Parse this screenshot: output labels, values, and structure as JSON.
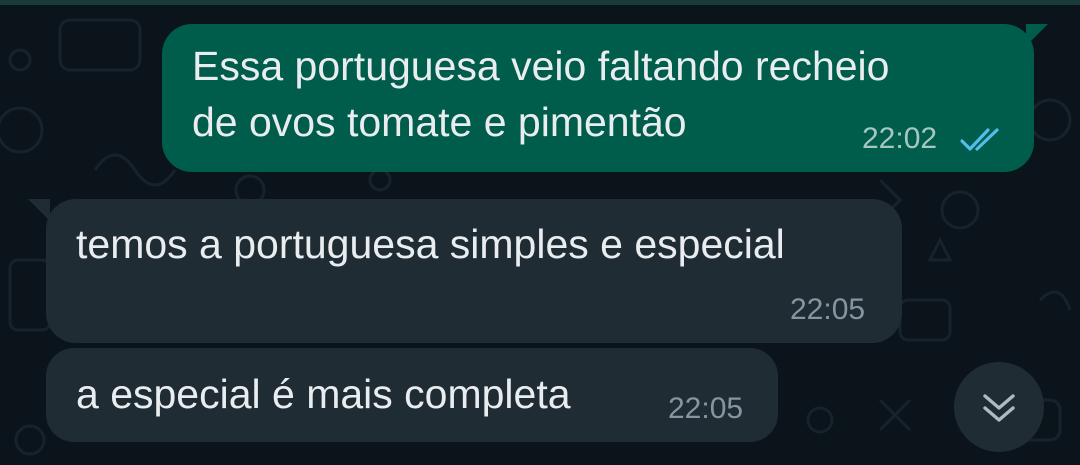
{
  "messages": [
    {
      "direction": "outgoing",
      "lines": [
        "Essa portuguesa veio faltando recheio",
        "de ovos tomate e pimentão"
      ],
      "time": "22:02",
      "status": "read",
      "status_icon": "double-check-icon",
      "status_color": "#53bdeb"
    },
    {
      "direction": "incoming",
      "lines": [
        "temos a portuguesa simples e especial"
      ],
      "time": "22:05"
    },
    {
      "direction": "incoming",
      "lines": [
        "a especial é mais completa"
      ],
      "time": "22:05"
    }
  ],
  "scroll_button": {
    "icon": "double-chevron-down-icon"
  },
  "colors": {
    "background": "#0b141a",
    "outgoing_bubble": "#005c4b",
    "incoming_bubble": "#202c33",
    "text": "#e9edef",
    "read_ticks": "#53bdeb"
  }
}
